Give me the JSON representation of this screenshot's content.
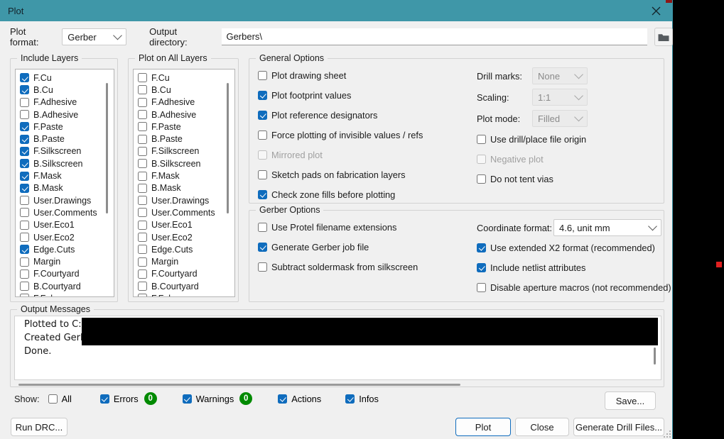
{
  "window": {
    "title": "Plot",
    "close_icon": "close-icon",
    "accent_color": "#3f97a8",
    "bg_color": "#f0f0f0"
  },
  "toolbar": {
    "plot_format_label": "Plot format:",
    "plot_format_value": "Gerber",
    "output_directory_label": "Output directory:",
    "output_directory_value": "Gerbers\\",
    "browse_icon": "folder-icon"
  },
  "include_layers": {
    "title": "Include Layers",
    "items": [
      {
        "label": "F.Cu",
        "checked": true
      },
      {
        "label": "B.Cu",
        "checked": true
      },
      {
        "label": "F.Adhesive",
        "checked": false
      },
      {
        "label": "B.Adhesive",
        "checked": false
      },
      {
        "label": "F.Paste",
        "checked": true
      },
      {
        "label": "B.Paste",
        "checked": true
      },
      {
        "label": "F.Silkscreen",
        "checked": true
      },
      {
        "label": "B.Silkscreen",
        "checked": true
      },
      {
        "label": "F.Mask",
        "checked": true
      },
      {
        "label": "B.Mask",
        "checked": true
      },
      {
        "label": "User.Drawings",
        "checked": false
      },
      {
        "label": "User.Comments",
        "checked": false
      },
      {
        "label": "User.Eco1",
        "checked": false
      },
      {
        "label": "User.Eco2",
        "checked": false
      },
      {
        "label": "Edge.Cuts",
        "checked": true
      },
      {
        "label": "Margin",
        "checked": false
      },
      {
        "label": "F.Courtyard",
        "checked": false
      },
      {
        "label": "B.Courtyard",
        "checked": false
      },
      {
        "label": "F.Fab",
        "checked": false
      }
    ]
  },
  "plot_on_all_layers": {
    "title": "Plot on All Layers",
    "items": [
      {
        "label": "F.Cu",
        "checked": false
      },
      {
        "label": "B.Cu",
        "checked": false
      },
      {
        "label": "F.Adhesive",
        "checked": false
      },
      {
        "label": "B.Adhesive",
        "checked": false
      },
      {
        "label": "F.Paste",
        "checked": false
      },
      {
        "label": "B.Paste",
        "checked": false
      },
      {
        "label": "F.Silkscreen",
        "checked": false
      },
      {
        "label": "B.Silkscreen",
        "checked": false
      },
      {
        "label": "F.Mask",
        "checked": false
      },
      {
        "label": "B.Mask",
        "checked": false
      },
      {
        "label": "User.Drawings",
        "checked": false
      },
      {
        "label": "User.Comments",
        "checked": false
      },
      {
        "label": "User.Eco1",
        "checked": false
      },
      {
        "label": "User.Eco2",
        "checked": false
      },
      {
        "label": "Edge.Cuts",
        "checked": false
      },
      {
        "label": "Margin",
        "checked": false
      },
      {
        "label": "F.Courtyard",
        "checked": false
      },
      {
        "label": "B.Courtyard",
        "checked": false
      },
      {
        "label": "F.Fab",
        "checked": false
      }
    ]
  },
  "general_options": {
    "title": "General Options",
    "checkboxes": [
      {
        "label": "Plot drawing sheet",
        "checked": false,
        "enabled": true
      },
      {
        "label": "Plot footprint values",
        "checked": true,
        "enabled": true
      },
      {
        "label": "Plot reference designators",
        "checked": true,
        "enabled": true
      },
      {
        "label": "Force plotting of invisible values / refs",
        "checked": false,
        "enabled": true
      },
      {
        "label": "Mirrored plot",
        "checked": false,
        "enabled": false
      },
      {
        "label": "Sketch pads on fabrication layers",
        "checked": false,
        "enabled": true
      },
      {
        "label": "Check zone fills before plotting",
        "checked": true,
        "enabled": true
      }
    ],
    "fields": [
      {
        "label": "Drill marks:",
        "value": "None",
        "enabled": false
      },
      {
        "label": "Scaling:",
        "value": "1:1",
        "enabled": false
      },
      {
        "label": "Plot mode:",
        "value": "Filled",
        "enabled": false
      }
    ],
    "right_checkboxes": [
      {
        "label": "Use drill/place file origin",
        "checked": false,
        "enabled": true
      },
      {
        "label": "Negative plot",
        "checked": false,
        "enabled": false
      },
      {
        "label": "Do not tent vias",
        "checked": false,
        "enabled": true
      }
    ]
  },
  "gerber_options": {
    "title": "Gerber Options",
    "checkboxes": [
      {
        "label": "Use Protel filename extensions",
        "checked": false,
        "enabled": true
      },
      {
        "label": "Generate Gerber job file",
        "checked": true,
        "enabled": true
      },
      {
        "label": "Subtract soldermask from silkscreen",
        "checked": false,
        "enabled": true
      }
    ],
    "coordinate_format_label": "Coordinate format:",
    "coordinate_format_value": "4.6, unit mm",
    "right_checkboxes": [
      {
        "label": "Use extended X2 format (recommended)",
        "checked": true,
        "enabled": true
      },
      {
        "label": "Include netlist attributes",
        "checked": true,
        "enabled": true
      },
      {
        "label": "Disable aperture macros (not recommended)",
        "checked": false,
        "enabled": true
      }
    ]
  },
  "output_messages": {
    "title": "Output Messages",
    "lines": [
      "Plotted to C:",
      "Created Gerber job file",
      "Done."
    ]
  },
  "show_row": {
    "label": "Show:",
    "items": [
      {
        "label": "All",
        "checked": false,
        "badge": null
      },
      {
        "label": "Errors",
        "checked": true,
        "badge": "0"
      },
      {
        "label": "Warnings",
        "checked": true,
        "badge": "0"
      },
      {
        "label": "Actions",
        "checked": true,
        "badge": null
      },
      {
        "label": "Infos",
        "checked": true,
        "badge": null
      }
    ],
    "badge_color": "#008a00",
    "save_label": "Save..."
  },
  "footer": {
    "run_drc_label": "Run DRC...",
    "plot_label": "Plot",
    "close_label": "Close",
    "generate_drill_files_label": "Generate Drill Files..."
  }
}
